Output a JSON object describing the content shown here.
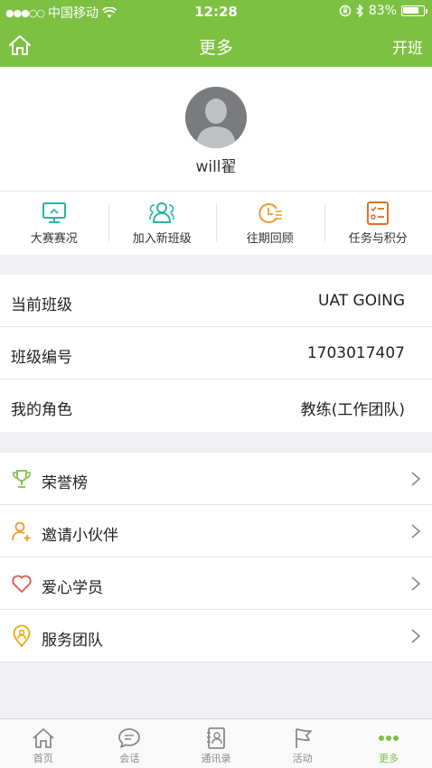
{
  "status_bar": {
    "signal": "●●●○○",
    "carrier": "中国移动",
    "time": "12:28",
    "battery": "83%",
    "battery_level": 0.83
  },
  "nav": {
    "title": "更多",
    "action": "开班",
    "home_icon": "home-icon"
  },
  "profile": {
    "username": "will翟"
  },
  "quick_actions": [
    {
      "label": "大赛赛况",
      "icon": "monitor-icon",
      "color": "#2bb3a3"
    },
    {
      "label": "加入新班级",
      "icon": "group-icon",
      "color": "#2bb3a3"
    },
    {
      "label": "往期回顾",
      "icon": "clock-list-icon",
      "color": "#f29a2e"
    },
    {
      "label": "任务与积分",
      "icon": "checklist-icon",
      "color": "#e0702c"
    }
  ],
  "class_info": [
    {
      "key": "当前班级",
      "value": "UAT GOING"
    },
    {
      "key": "班级编号",
      "value": "1703017407"
    },
    {
      "key": "我的角色",
      "value": "教练(工作团队)"
    }
  ],
  "menu": [
    {
      "label": "荣誉榜",
      "icon": "trophy-icon",
      "color": "#7dc142"
    },
    {
      "label": "邀请小伙伴",
      "icon": "add-person-icon",
      "color": "#f29a2e"
    },
    {
      "label": "爱心学员",
      "icon": "heart-icon",
      "color": "#e2554f"
    },
    {
      "label": "服务团队",
      "icon": "location-person-icon",
      "color": "#f0a500"
    }
  ],
  "tabs": [
    {
      "label": "首页",
      "icon": "home-icon",
      "active": false
    },
    {
      "label": "会话",
      "icon": "chat-icon",
      "active": false
    },
    {
      "label": "通讯录",
      "icon": "contacts-icon",
      "active": false
    },
    {
      "label": "活动",
      "icon": "flag-icon",
      "active": false
    },
    {
      "label": "更多",
      "icon": "more-icon",
      "active": true
    }
  ],
  "colors": {
    "brand_green": "#7dc142",
    "background": "#efeff4"
  }
}
